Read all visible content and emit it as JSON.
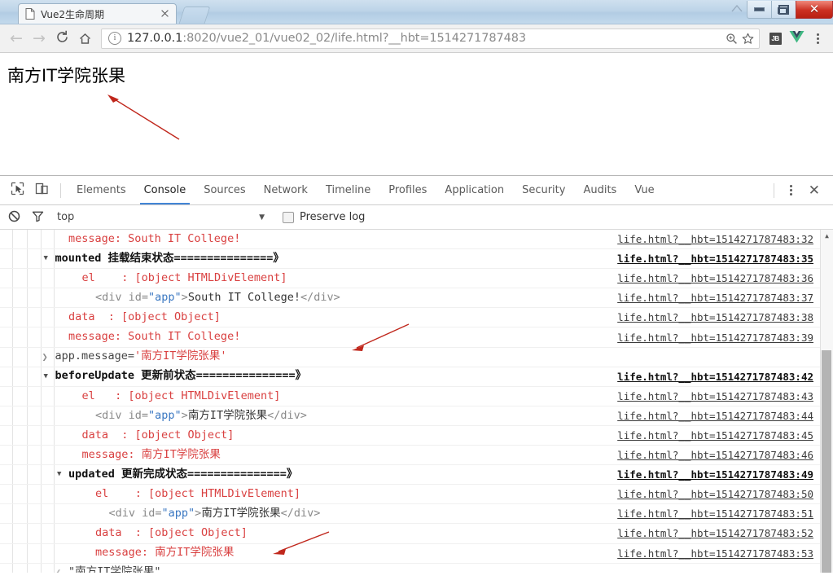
{
  "window": {
    "controls": {
      "minimize": "minimize",
      "maximize": "maximize",
      "close": "close"
    }
  },
  "tab": {
    "title": "Vue2生命周期",
    "favicon": "document-icon",
    "close_label": "×"
  },
  "toolbar": {
    "back": "←",
    "forward": "→",
    "reload": "⟳",
    "home": "home-icon",
    "url_main": "127.0.0.1",
    "url_rest": ":8020/vue2_01/vue02_02/life.html?__hbt=1514271787483",
    "url_full": "127.0.0.1:8020/vue2_01/vue02_02/life.html?__hbt=1514271787483",
    "zoom_icon": "zoom-search-icon",
    "bookmark_icon": "star-icon",
    "ext_jb": "JB",
    "ext_vue": "vue-logo-icon",
    "menu": "kebab-menu-icon"
  },
  "page": {
    "body_text": "南方IT学院张果"
  },
  "devtools": {
    "inspect_icon": "inspect-element-icon",
    "device_icon": "device-toolbar-icon",
    "tabs": [
      {
        "label": "Elements",
        "active": false
      },
      {
        "label": "Console",
        "active": true
      },
      {
        "label": "Sources",
        "active": false
      },
      {
        "label": "Network",
        "active": false
      },
      {
        "label": "Timeline",
        "active": false
      },
      {
        "label": "Profiles",
        "active": false
      },
      {
        "label": "Application",
        "active": false
      },
      {
        "label": "Security",
        "active": false
      },
      {
        "label": "Audits",
        "active": false
      },
      {
        "label": "Vue",
        "active": false
      }
    ],
    "more_icon": "kebab-menu-icon",
    "close_icon": "close-panel-icon",
    "filterbar": {
      "clear_icon": "clear-console-icon",
      "filter_icon": "filter-icon",
      "context": "top",
      "context_caret": "▼",
      "preserve_log_label": "Preserve log",
      "preserve_log_checked": false
    },
    "console_rows": [
      {
        "indent": 4,
        "marker": "none",
        "src": "life.html?__hbt=1514271787483:32",
        "group": false,
        "parts": [
          {
            "t": "message: South IT College!",
            "c": "c-red"
          }
        ]
      },
      {
        "indent": 3,
        "marker": "down",
        "src": "life.html?__hbt=1514271787483:35",
        "group": true,
        "parts": [
          {
            "t": "mounted 挂载结束状态===============》",
            "c": "c-dark"
          }
        ]
      },
      {
        "indent": 5,
        "marker": "none",
        "src": "life.html?__hbt=1514271787483:36",
        "group": false,
        "parts": [
          {
            "t": "el    : [object HTMLDivElement]",
            "c": "c-red"
          }
        ]
      },
      {
        "indent": 6,
        "marker": "none",
        "src": "life.html?__hbt=1514271787483:37",
        "group": false,
        "parts": [
          {
            "t": "<div ",
            "c": "c-html"
          },
          {
            "t": "id=",
            "c": "c-html"
          },
          {
            "t": "\"app\"",
            "c": "c-attr"
          },
          {
            "t": ">",
            "c": "c-html"
          },
          {
            "t": "South IT College!",
            "c": "c-txt"
          },
          {
            "t": "</div>",
            "c": "c-html"
          }
        ]
      },
      {
        "indent": 4,
        "marker": "none",
        "src": "life.html?__hbt=1514271787483:38",
        "group": false,
        "parts": [
          {
            "t": "data  : [object Object]",
            "c": "c-red"
          }
        ]
      },
      {
        "indent": 4,
        "marker": "none",
        "src": "life.html?__hbt=1514271787483:39",
        "group": false,
        "parts": [
          {
            "t": "message: South IT College!",
            "c": "c-red"
          }
        ]
      },
      {
        "indent": 3,
        "marker": "input",
        "src": "",
        "group": false,
        "parts": [
          {
            "t": "app.message=",
            "c": "c-val"
          },
          {
            "t": "'南方IT学院张果'",
            "c": "c-red"
          }
        ]
      },
      {
        "indent": 3,
        "marker": "down",
        "src": "life.html?__hbt=1514271787483:42",
        "group": true,
        "parts": [
          {
            "t": "beforeUpdate 更新前状态===============》",
            "c": "c-dark"
          }
        ]
      },
      {
        "indent": 5,
        "marker": "none",
        "src": "life.html?__hbt=1514271787483:43",
        "group": false,
        "parts": [
          {
            "t": "el   : [object HTMLDivElement]",
            "c": "c-red"
          }
        ]
      },
      {
        "indent": 6,
        "marker": "none",
        "src": "life.html?__hbt=1514271787483:44",
        "group": false,
        "parts": [
          {
            "t": "<div ",
            "c": "c-html"
          },
          {
            "t": "id=",
            "c": "c-html"
          },
          {
            "t": "\"app\"",
            "c": "c-attr"
          },
          {
            "t": ">",
            "c": "c-html"
          },
          {
            "t": "南方IT学院张果",
            "c": "c-txt"
          },
          {
            "t": "</div>",
            "c": "c-html"
          }
        ]
      },
      {
        "indent": 5,
        "marker": "none",
        "src": "life.html?__hbt=1514271787483:45",
        "group": false,
        "parts": [
          {
            "t": "data  : [object Object]",
            "c": "c-red"
          }
        ]
      },
      {
        "indent": 5,
        "marker": "none",
        "src": "life.html?__hbt=1514271787483:46",
        "group": false,
        "parts": [
          {
            "t": "message: 南方IT学院张果",
            "c": "c-red"
          }
        ]
      },
      {
        "indent": 4,
        "marker": "down",
        "src": "life.html?__hbt=1514271787483:49",
        "group": true,
        "parts": [
          {
            "t": "updated 更新完成状态===============》",
            "c": "c-dark"
          }
        ]
      },
      {
        "indent": 6,
        "marker": "none",
        "src": "life.html?__hbt=1514271787483:50",
        "group": false,
        "parts": [
          {
            "t": "el    : [object HTMLDivElement]",
            "c": "c-red"
          }
        ]
      },
      {
        "indent": 7,
        "marker": "none",
        "src": "life.html?__hbt=1514271787483:51",
        "group": false,
        "parts": [
          {
            "t": "<div ",
            "c": "c-html"
          },
          {
            "t": "id=",
            "c": "c-html"
          },
          {
            "t": "\"app\"",
            "c": "c-attr"
          },
          {
            "t": ">",
            "c": "c-html"
          },
          {
            "t": "南方IT学院张果",
            "c": "c-txt"
          },
          {
            "t": "</div>",
            "c": "c-html"
          }
        ]
      },
      {
        "indent": 6,
        "marker": "none",
        "src": "life.html?__hbt=1514271787483:52",
        "group": false,
        "parts": [
          {
            "t": "data  : [object Object]",
            "c": "c-red"
          }
        ]
      },
      {
        "indent": 6,
        "marker": "none",
        "src": "life.html?__hbt=1514271787483:53",
        "group": false,
        "parts": [
          {
            "t": "message: 南方IT学院张果",
            "c": "c-red"
          }
        ]
      },
      {
        "indent": 4,
        "marker": "output",
        "src": "",
        "group": false,
        "parts": [
          {
            "t": "\"南方IT学院张果\"",
            "c": "c-val"
          }
        ]
      }
    ],
    "scrollbar": {
      "up_arrow": "▲"
    }
  },
  "annotations": {
    "color": "#c0271c",
    "arrows": [
      {
        "name": "arrow-page-text"
      },
      {
        "name": "arrow-console-input"
      },
      {
        "name": "arrow-updated-message"
      }
    ]
  }
}
